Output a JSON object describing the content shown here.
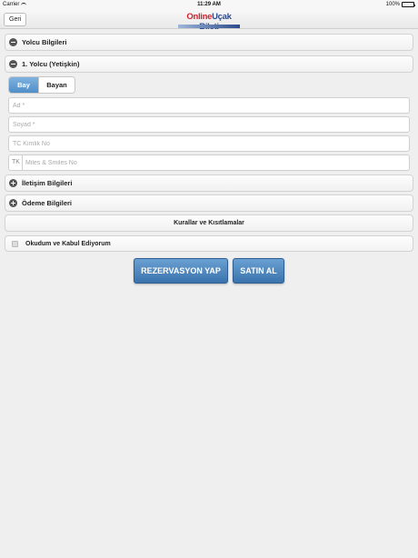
{
  "status_bar": {
    "carrier": "Carrier",
    "time": "11:29 AM",
    "battery": "100%",
    "battery_level": 1.0
  },
  "nav": {
    "back_label": "Geri",
    "logo_part1": "Online",
    "logo_part2": "Uçak Bileti"
  },
  "sections": {
    "passenger_info": "Yolcu Bilgileri",
    "passenger_1": "1. Yolcu (Yetişkin)",
    "contact_info": "İletişim Bilgileri",
    "payment_info": "Ödeme Bilgileri"
  },
  "gender": {
    "options": [
      "Bay",
      "Bayan"
    ],
    "selected": "Bay"
  },
  "fields": {
    "first_name_placeholder": "Ad *",
    "last_name_placeholder": "Soyad *",
    "tc_placeholder": "TC Kimlik No",
    "tk_prefix": "TK",
    "miles_placeholder": "Miles & Smiles No"
  },
  "rules_label": "Kurallar ve Kısıtlamalar",
  "accept_label": "Okudum ve Kabul Ediyorum",
  "buttons": {
    "reserve": "REZERVASYON YAP",
    "buy": "SATIN AL"
  }
}
